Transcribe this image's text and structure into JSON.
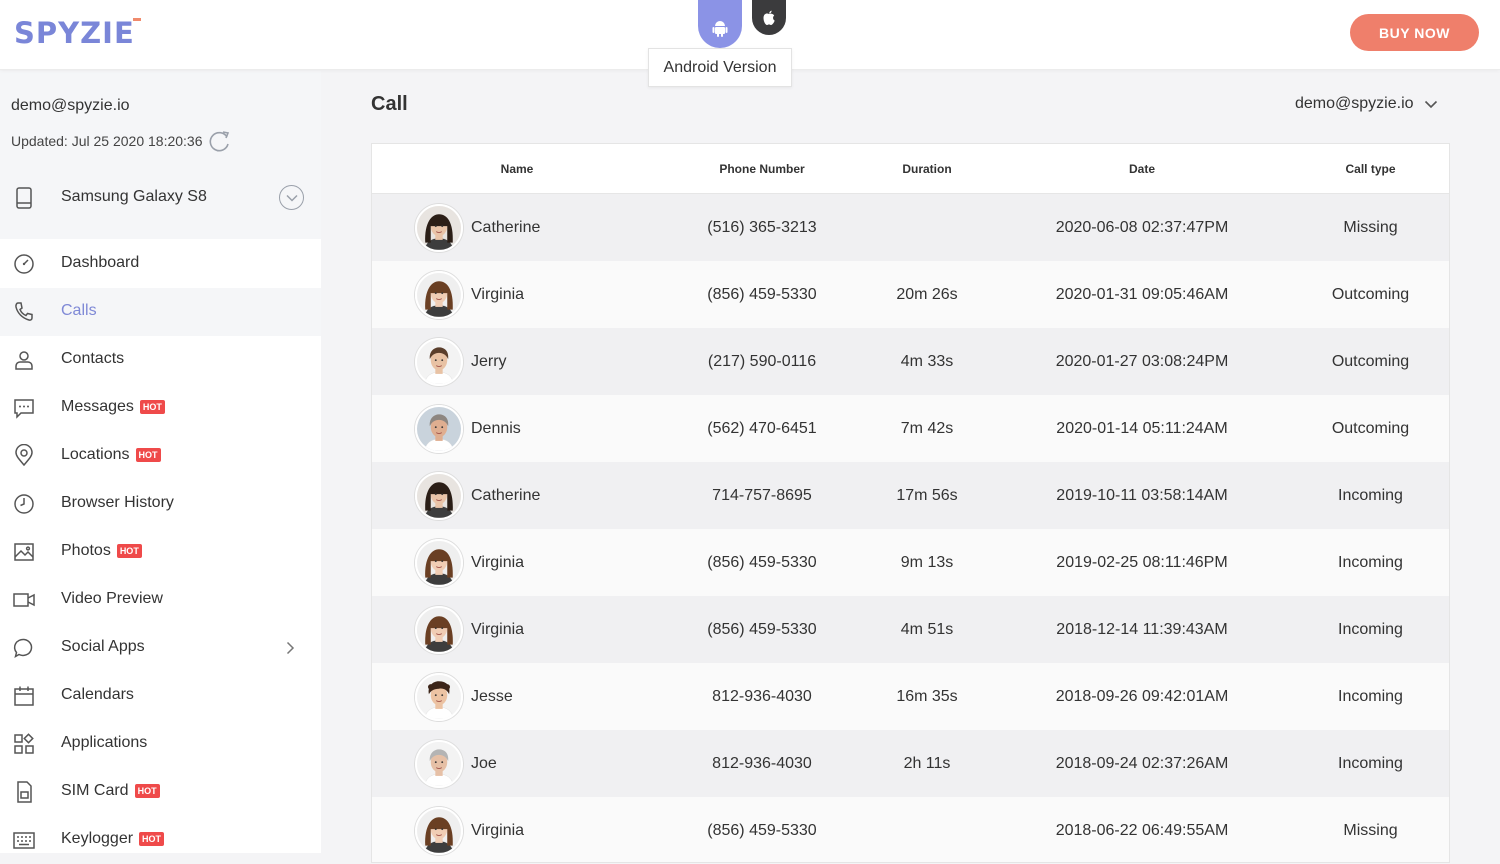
{
  "header": {
    "logo": "SPYZIE",
    "tooltip": "Android Version",
    "buy_label": "BUY NOW",
    "colors": {
      "brand": "#7a86d8",
      "buy": "#ef7f6b",
      "android": "#8b93e6",
      "apple": "#3b3b3d"
    }
  },
  "sidebar": {
    "email": "demo@spyzie.io",
    "updated": "Updated: Jul 25 2020 18:20:36",
    "device": "Samsung Galaxy S8",
    "hot_label": "HOT",
    "items": [
      {
        "label": "Dashboard",
        "icon": "dashboard-icon",
        "hot": false
      },
      {
        "label": "Calls",
        "icon": "phone-icon",
        "hot": false,
        "active": true
      },
      {
        "label": "Contacts",
        "icon": "contacts-icon",
        "hot": false
      },
      {
        "label": "Messages",
        "icon": "messages-icon",
        "hot": true
      },
      {
        "label": "Locations",
        "icon": "location-icon",
        "hot": true
      },
      {
        "label": "Browser History",
        "icon": "clock-icon",
        "hot": false
      },
      {
        "label": "Photos",
        "icon": "photo-icon",
        "hot": true
      },
      {
        "label": "Video Preview",
        "icon": "video-icon",
        "hot": false
      },
      {
        "label": "Social Apps",
        "icon": "chat-icon",
        "hot": false,
        "chevron": true
      },
      {
        "label": "Calendars",
        "icon": "calendar-icon",
        "hot": false
      },
      {
        "label": "Applications",
        "icon": "apps-icon",
        "hot": false
      },
      {
        "label": "SIM Card",
        "icon": "sim-icon",
        "hot": true
      },
      {
        "label": "Keylogger",
        "icon": "keyboard-icon",
        "hot": true
      }
    ]
  },
  "main": {
    "title": "Call",
    "user": "demo@spyzie.io",
    "columns": [
      "Name",
      "Phone Number",
      "Duration",
      "Date",
      "Call type"
    ],
    "rows": [
      {
        "name": "Catherine",
        "phone": "(516) 365-3213",
        "duration": "",
        "date": "2020-06-08 02:37:47PM",
        "type": "Missing",
        "avatar": "woman-dark-hair"
      },
      {
        "name": "Virginia",
        "phone": "(856) 459-5330",
        "duration": "20m 26s",
        "date": "2020-01-31 09:05:46AM",
        "type": "Outcoming",
        "avatar": "woman-brown-hair"
      },
      {
        "name": "Jerry",
        "phone": "(217) 590-0116",
        "duration": "4m 33s",
        "date": "2020-01-27 03:08:24PM",
        "type": "Outcoming",
        "avatar": "man-short-hair"
      },
      {
        "name": "Dennis",
        "phone": "(562) 470-6451",
        "duration": "7m 42s",
        "date": "2020-01-14 05:11:24AM",
        "type": "Outcoming",
        "avatar": "man-older"
      },
      {
        "name": "Catherine",
        "phone": "714-757-8695",
        "duration": "17m 56s",
        "date": "2019-10-11 03:58:14AM",
        "type": "Incoming",
        "avatar": "woman-dark-hair"
      },
      {
        "name": "Virginia",
        "phone": "(856) 459-5330",
        "duration": "9m 13s",
        "date": "2019-02-25 08:11:46PM",
        "type": "Incoming",
        "avatar": "woman-brown-hair"
      },
      {
        "name": "Virginia",
        "phone": "(856) 459-5330",
        "duration": "4m 51s",
        "date": "2018-12-14 11:39:43AM",
        "type": "Incoming",
        "avatar": "woman-brown-hair"
      },
      {
        "name": "Jesse",
        "phone": "812-936-4030",
        "duration": "16m 35s",
        "date": "2018-09-26 09:42:01AM",
        "type": "Incoming",
        "avatar": "man-curly-hair"
      },
      {
        "name": "Joe",
        "phone": "812-936-4030",
        "duration": "2h 11s",
        "date": "2018-09-24 02:37:26AM",
        "type": "Incoming",
        "avatar": "man-grey-hair"
      },
      {
        "name": "Virginia",
        "phone": "(856) 459-5330",
        "duration": "",
        "date": "2018-06-22 06:49:55AM",
        "type": "Missing",
        "avatar": "woman-brown-hair"
      }
    ]
  }
}
